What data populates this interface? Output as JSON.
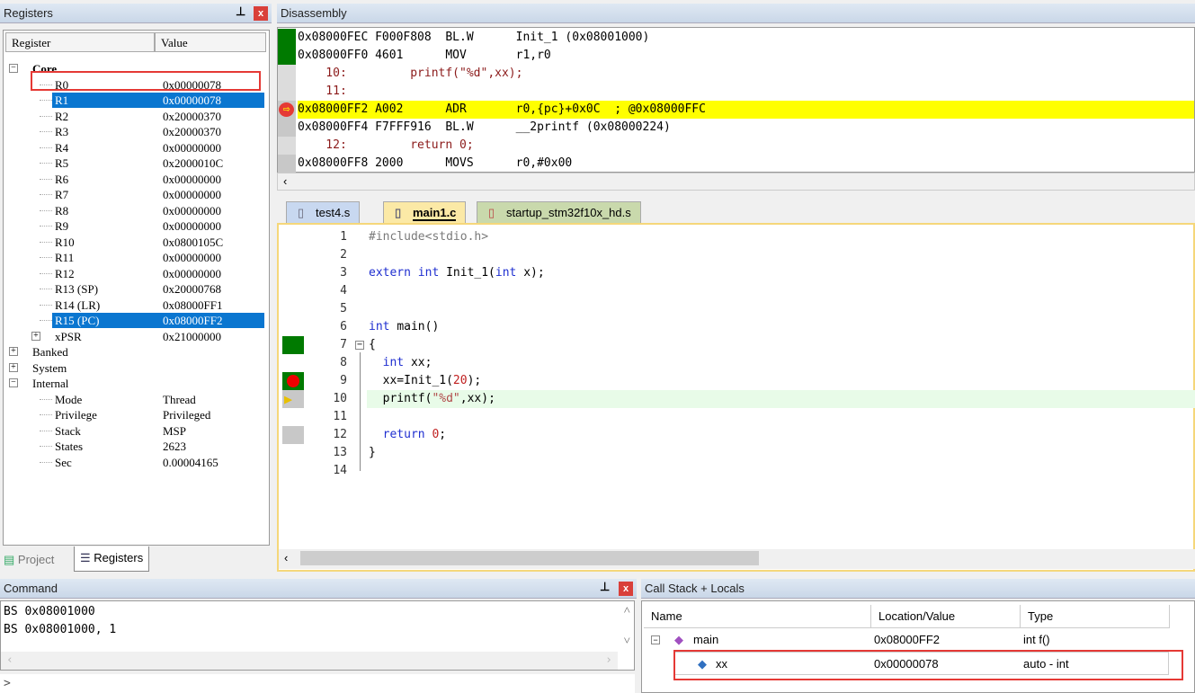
{
  "registers": {
    "title": "Registers",
    "col_register": "Register",
    "col_value": "Value",
    "rows": [
      {
        "name": "Core",
        "value": "",
        "level": 0,
        "bold": true,
        "expander": "minus"
      },
      {
        "name": "R0",
        "value": "0x00000078",
        "level": 1,
        "highlighted_box": true
      },
      {
        "name": "R1",
        "value": "0x00000078",
        "level": 1,
        "selected": true
      },
      {
        "name": "R2",
        "value": "0x20000370",
        "level": 1
      },
      {
        "name": "R3",
        "value": "0x20000370",
        "level": 1
      },
      {
        "name": "R4",
        "value": "0x00000000",
        "level": 1
      },
      {
        "name": "R5",
        "value": "0x2000010C",
        "level": 1
      },
      {
        "name": "R6",
        "value": "0x00000000",
        "level": 1
      },
      {
        "name": "R7",
        "value": "0x00000000",
        "level": 1
      },
      {
        "name": "R8",
        "value": "0x00000000",
        "level": 1
      },
      {
        "name": "R9",
        "value": "0x00000000",
        "level": 1
      },
      {
        "name": "R10",
        "value": "0x0800105C",
        "level": 1
      },
      {
        "name": "R11",
        "value": "0x00000000",
        "level": 1
      },
      {
        "name": "R12",
        "value": "0x00000000",
        "level": 1
      },
      {
        "name": "R13 (SP)",
        "value": "0x20000768",
        "level": 1
      },
      {
        "name": "R14 (LR)",
        "value": "0x08000FF1",
        "level": 1
      },
      {
        "name": "R15 (PC)",
        "value": "0x08000FF2",
        "level": 1,
        "selected": true
      },
      {
        "name": "xPSR",
        "value": "0x21000000",
        "level": 1,
        "expander": "plus"
      },
      {
        "name": "Banked",
        "value": "",
        "level": 0,
        "expander": "plus"
      },
      {
        "name": "System",
        "value": "",
        "level": 0,
        "expander": "plus"
      },
      {
        "name": "Internal",
        "value": "",
        "level": 0,
        "expander": "minus"
      },
      {
        "name": "Mode",
        "value": "Thread",
        "level": 1
      },
      {
        "name": "Privilege",
        "value": "Privileged",
        "level": 1
      },
      {
        "name": "Stack",
        "value": "MSP",
        "level": 1
      },
      {
        "name": "States",
        "value": "2623",
        "level": 1
      },
      {
        "name": "Sec",
        "value": "0.00004165",
        "level": 1
      }
    ],
    "tabs": [
      {
        "label": "Project",
        "icon": "project-icon"
      },
      {
        "label": "Registers",
        "icon": "registers-icon",
        "active": true
      }
    ]
  },
  "disassembly": {
    "title": "Disassembly",
    "lines": [
      {
        "text": "0x08000FEC F000F808  BL.W      Init_1 (0x08001000)",
        "kind": "asm",
        "marker": "green"
      },
      {
        "text": "0x08000FF0 4601      MOV       r1,r0",
        "kind": "asm",
        "marker": "green"
      },
      {
        "text": "    10:         printf(\"%d\",xx);",
        "kind": "src",
        "marker": "dots"
      },
      {
        "text": "    11:",
        "kind": "src",
        "marker": "dots"
      },
      {
        "text": "0x08000FF2 A002      ADR       r0,{pc}+0x0C  ; @0x08000FFC",
        "kind": "asm",
        "marker": "current",
        "current": true
      },
      {
        "text": "0x08000FF4 F7FFF916  BL.W      __2printf (0x08000224)",
        "kind": "asm",
        "marker": "gray"
      },
      {
        "text": "    12:         return 0;",
        "kind": "src",
        "marker": "dots"
      },
      {
        "text": "0x08000FF8 2000      MOVS      r0,#0x00",
        "kind": "asm",
        "marker": "gray"
      }
    ]
  },
  "editor": {
    "tabs": [
      {
        "label": "test4.s",
        "color": "#c8d8f0"
      },
      {
        "label": "main1.c",
        "color": "#fbe9a6",
        "active": true
      },
      {
        "label": "startup_stm32f10x_hd.s",
        "color": "#c9d9ac"
      }
    ],
    "lines": [
      {
        "n": "1",
        "html": [
          [
            "pp",
            "#include<stdio.h>"
          ]
        ]
      },
      {
        "n": "2",
        "html": []
      },
      {
        "n": "3",
        "html": [
          [
            "kw",
            "extern int "
          ],
          [
            "",
            "Init_1("
          ],
          [
            "kw",
            "int"
          ],
          [
            "",
            " x);"
          ]
        ]
      },
      {
        "n": "4",
        "html": []
      },
      {
        "n": "5",
        "html": []
      },
      {
        "n": "6",
        "html": [
          [
            "kw",
            "int "
          ],
          [
            "",
            "main()"
          ]
        ]
      },
      {
        "n": "7",
        "html": [
          [
            "",
            "{"
          ]
        ],
        "marker": "green",
        "fold": true
      },
      {
        "n": "8",
        "html": [
          [
            "kw",
            "  int "
          ],
          [
            "",
            "xx;"
          ]
        ]
      },
      {
        "n": "9",
        "html": [
          [
            "",
            "  xx=Init_1("
          ],
          [
            "num",
            "20"
          ],
          [
            "",
            ");"
          ]
        ],
        "marker": "breakpoint"
      },
      {
        "n": "10",
        "html": [
          [
            "",
            "  printf("
          ],
          [
            "str",
            "\"%d\""
          ],
          [
            "",
            ",xx);"
          ]
        ],
        "marker": "current",
        "current": true
      },
      {
        "n": "11",
        "html": []
      },
      {
        "n": "12",
        "html": [
          [
            "kw",
            "  return "
          ],
          [
            "num",
            "0"
          ],
          [
            "",
            ";"
          ]
        ],
        "marker": "gray"
      },
      {
        "n": "13",
        "html": [
          [
            "",
            "}"
          ]
        ]
      },
      {
        "n": "14",
        "html": []
      }
    ]
  },
  "command": {
    "title": "Command",
    "lines": [
      "BS 0x08001000",
      "BS 0x08001000, 1"
    ],
    "prompt": ">"
  },
  "callstack": {
    "title": "Call Stack + Locals",
    "columns": [
      "Name",
      "Location/Value",
      "Type"
    ],
    "rows": [
      {
        "name": "main",
        "value": "0x08000FF2",
        "type": "int f()",
        "icon": "function-icon"
      },
      {
        "name": "xx",
        "value": "0x00000078",
        "type": "auto - int",
        "icon": "variable-icon",
        "highlighted_box": true
      }
    ]
  },
  "colors": {
    "selection": "#0a76d0",
    "current_line": "#ffff00",
    "highlight_box": "#e53935",
    "exec_green": "#007a00"
  }
}
